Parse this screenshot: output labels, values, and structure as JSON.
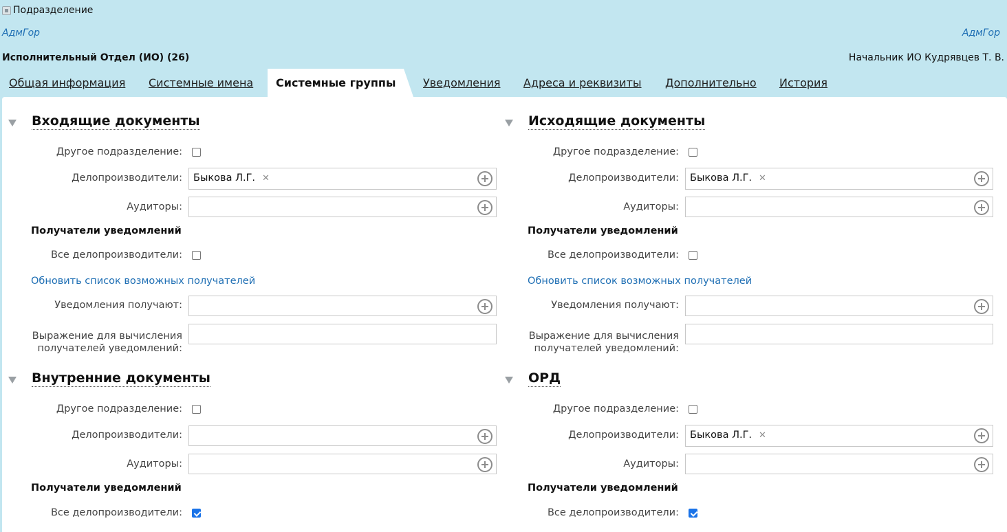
{
  "window": {
    "title": "Подразделение",
    "icon": "window-icon"
  },
  "org": {
    "left_label": "АдмГор",
    "right_label": "АдмГор"
  },
  "department": {
    "title": "Исполнительный Отдел (ИО) (26)",
    "head": "Начальник ИО Кудрявцев Т. В."
  },
  "tabs": [
    {
      "label": "Общая информация",
      "active": false
    },
    {
      "label": "Системные имена",
      "active": false
    },
    {
      "label": "Системные группы",
      "active": true
    },
    {
      "label": "Уведомления",
      "active": false
    },
    {
      "label": "Адреса и реквизиты",
      "active": false
    },
    {
      "label": "Дополнительно",
      "active": false
    },
    {
      "label": "История",
      "active": false
    }
  ],
  "labels": {
    "other_dept": "Другое подразделение:",
    "clerks": "Делопроизводители:",
    "auditors": "Аудиторы:",
    "recipients_header": "Получатели уведомлений",
    "all_clerks": "Все делопроизводители:",
    "refresh_link": "Обновить список возможных получателей",
    "notified": "Уведомления получают:",
    "expression_line1": "Выражение для вычисления",
    "expression_line2": "получателей уведомлений:"
  },
  "sections": {
    "incoming": {
      "title": "Входящие документы",
      "other_dept": false,
      "clerk": "Быкова Л.Г.",
      "all_clerks": false
    },
    "outgoing": {
      "title": "Исходящие документы",
      "other_dept": false,
      "clerk": "Быкова Л.Г.",
      "all_clerks": false
    },
    "internal": {
      "title": "Внутренние документы",
      "other_dept": false,
      "clerk": "",
      "all_clerks": true
    },
    "ord": {
      "title": "ОРД",
      "other_dept": false,
      "clerk": "Быкова Л.Г.",
      "all_clerks": true
    }
  }
}
